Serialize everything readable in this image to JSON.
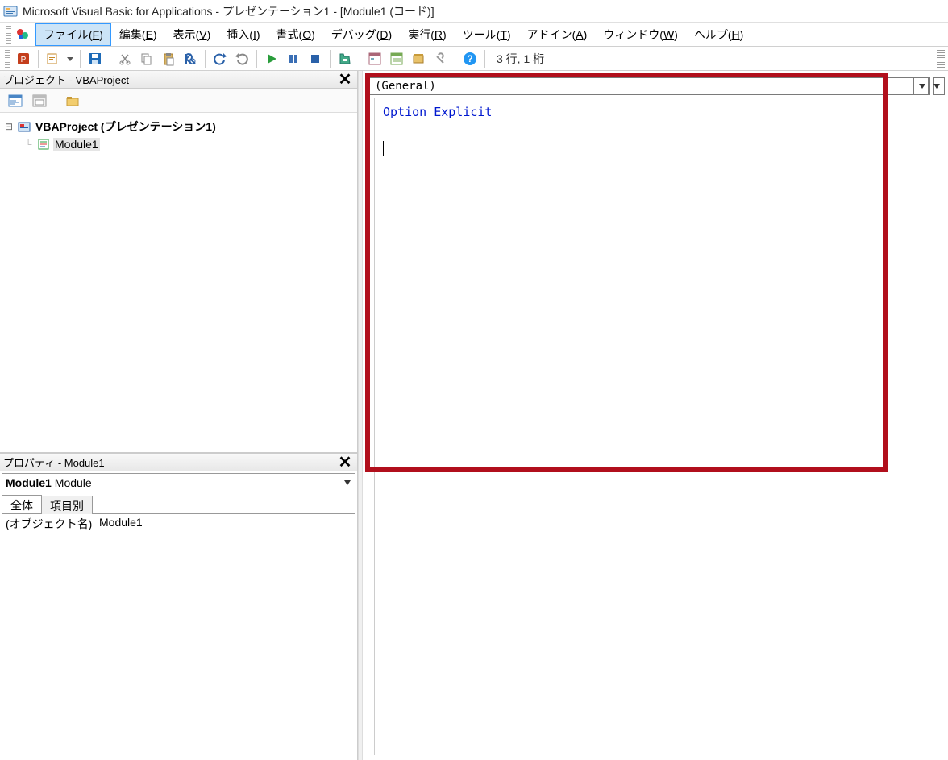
{
  "title": "Microsoft Visual Basic for Applications - プレゼンテーション1 - [Module1 (コード)]",
  "menus": {
    "file": {
      "label": "ファイル",
      "key": "F"
    },
    "edit": {
      "label": "編集",
      "key": "E"
    },
    "view": {
      "label": "表示",
      "key": "V"
    },
    "insert": {
      "label": "挿入",
      "key": "I"
    },
    "format": {
      "label": "書式",
      "key": "O"
    },
    "debug": {
      "label": "デバッグ",
      "key": "D"
    },
    "run": {
      "label": "実行",
      "key": "R"
    },
    "tools": {
      "label": "ツール",
      "key": "T"
    },
    "addins": {
      "label": "アドイン",
      "key": "A"
    },
    "window": {
      "label": "ウィンドウ",
      "key": "W"
    },
    "help": {
      "label": "ヘルプ",
      "key": "H"
    }
  },
  "toolbar": {
    "cursor_pos": "3 行, 1 桁"
  },
  "project_pane": {
    "title": "プロジェクト - VBAProject",
    "root": "VBAProject (プレゼンテーション1)",
    "module": "Module1"
  },
  "properties_pane": {
    "title": "プロパティ - Module1",
    "combo_name": "Module1",
    "combo_type": "Module",
    "tabs": {
      "all": "全体",
      "by_cat": "項目別"
    },
    "row_name": "(オブジェクト名)",
    "row_val": "Module1"
  },
  "code": {
    "left_combo": "(General)",
    "line1": "Option Explicit"
  }
}
